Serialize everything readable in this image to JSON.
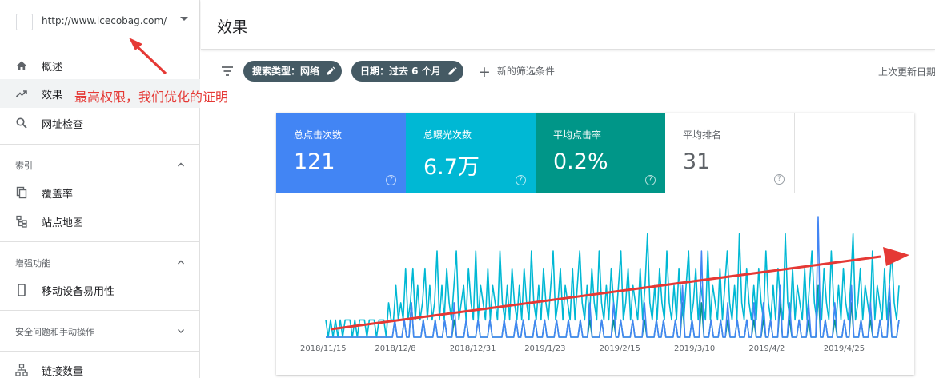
{
  "property": {
    "url": "http://www.icecobag.com/"
  },
  "nav": {
    "overview": "概述",
    "performance": "效果",
    "url_inspection": "网址检查",
    "index_section": "索引",
    "coverage": "覆盖率",
    "sitemaps": "站点地图",
    "enhancements_section": "增强功能",
    "mobile_usability": "移动设备易用性",
    "security_section": "安全问题和手动操作",
    "links": "链接数量"
  },
  "header": {
    "title": "效果"
  },
  "filters": {
    "search_type": "搜索类型：网络",
    "date": "日期：过去 6 个月",
    "add_filter": "新的筛选条件",
    "last_updated": "上次更新日期"
  },
  "metrics": {
    "clicks": {
      "label": "总点击次数",
      "value": "121"
    },
    "impressions": {
      "label": "总曝光次数",
      "value": "6.7万"
    },
    "ctr": {
      "label": "平均点击率",
      "value": "0.2%"
    },
    "position": {
      "label": "平均排名",
      "value": "31"
    }
  },
  "annotation": "最高权限，我们优化的证明",
  "colors": {
    "clicks": "#4285f4",
    "impressions": "#00b8d4",
    "ctr": "#009688",
    "position": "#9e9e9e",
    "annotation": "#e53935"
  },
  "chart_data": {
    "type": "line",
    "x_tick_labels": [
      "2018/11/15",
      "2018/12/8",
      "2018/12/31",
      "2019/1/23",
      "2019/2/15",
      "2019/3/10",
      "2019/4/2",
      "2019/4/25"
    ],
    "y_axis": "hidden",
    "series": [
      {
        "name": "总点击次数",
        "color": "#4285f4",
        "values": [
          0,
          0,
          0,
          0,
          0,
          0,
          0,
          0,
          0,
          0,
          0,
          0,
          0,
          0,
          0,
          0,
          0,
          0,
          0,
          0,
          0,
          0,
          0,
          0,
          0,
          0,
          0,
          0,
          0,
          1,
          0,
          0,
          0,
          1,
          0,
          0,
          2,
          0,
          0,
          0,
          0,
          1,
          0,
          0,
          0,
          0,
          1,
          0,
          0,
          0,
          1,
          0,
          0,
          0,
          2,
          0,
          0,
          0,
          0,
          1,
          0,
          0,
          0,
          0,
          1,
          0,
          0,
          0,
          0,
          1,
          0,
          0,
          0,
          0,
          0,
          1,
          0,
          0,
          0,
          0,
          1,
          0,
          0,
          1,
          0,
          0,
          0,
          0,
          1,
          0,
          0,
          0,
          1,
          0,
          0,
          0,
          0,
          1,
          0,
          0,
          0,
          0,
          1,
          0,
          0,
          0,
          0,
          1,
          0,
          0,
          0,
          2,
          0,
          0,
          0,
          0,
          1,
          0,
          0,
          0,
          0,
          2,
          0,
          0,
          1,
          0,
          0,
          0,
          0,
          1,
          0,
          0,
          0,
          0,
          2,
          0,
          0,
          0,
          0,
          1,
          0,
          0,
          1,
          0,
          0,
          0,
          0,
          1,
          0,
          0,
          3,
          0,
          0,
          0,
          1,
          0,
          0,
          0,
          5,
          0,
          0,
          0,
          1,
          0,
          0,
          0,
          1,
          0,
          0,
          2,
          0,
          0,
          0,
          1,
          0,
          0,
          0,
          1,
          0,
          0,
          2,
          0,
          0,
          0,
          2,
          0,
          0,
          1,
          0,
          0,
          0,
          3,
          0,
          0,
          0,
          2,
          0,
          0,
          0,
          1,
          0,
          0,
          0,
          2,
          0,
          0,
          0,
          7,
          0,
          0,
          1,
          0,
          0,
          0,
          2,
          0,
          0,
          0,
          1,
          0,
          0,
          3,
          0,
          0,
          0,
          1,
          0,
          0,
          0,
          2,
          0,
          0,
          0,
          1,
          0,
          0,
          0,
          3,
          0,
          0,
          0,
          1
        ]
      },
      {
        "name": "总曝光次数",
        "color": "#00b8d4",
        "values": [
          1,
          0,
          1,
          0,
          1,
          0,
          1,
          0,
          1,
          1,
          1,
          0,
          1,
          0,
          1,
          1,
          1,
          0,
          1,
          1,
          1,
          0,
          1,
          1,
          1,
          0,
          2,
          1,
          1,
          3,
          1,
          2,
          1,
          4,
          1,
          2,
          4,
          1,
          3,
          1,
          2,
          4,
          1,
          3,
          1,
          2,
          5,
          1,
          3,
          1,
          4,
          2,
          1,
          3,
          5,
          1,
          2,
          3,
          1,
          4,
          2,
          1,
          5,
          1,
          3,
          2,
          1,
          4,
          1,
          3,
          2,
          1,
          5,
          2,
          1,
          3,
          1,
          4,
          2,
          1,
          3,
          1,
          4,
          2,
          1,
          5,
          2,
          1,
          3,
          1,
          4,
          2,
          1,
          3,
          5,
          1,
          2,
          4,
          1,
          3,
          2,
          1,
          4,
          1,
          3,
          5,
          2,
          1,
          3,
          1,
          4,
          2,
          1,
          5,
          2,
          1,
          3,
          1,
          4,
          2,
          1,
          3,
          5,
          1,
          2,
          4,
          1,
          3,
          2,
          1,
          4,
          1,
          3,
          6,
          2,
          1,
          3,
          1,
          4,
          2,
          1,
          5,
          2,
          1,
          3,
          1,
          4,
          2,
          1,
          3,
          5,
          1,
          2,
          4,
          1,
          3,
          2,
          1,
          5,
          1,
          3,
          2,
          1,
          4,
          1,
          3,
          5,
          2,
          1,
          3,
          1,
          6,
          2,
          1,
          4,
          2,
          1,
          3,
          1,
          4,
          2,
          1,
          5,
          2,
          1,
          3,
          1,
          4,
          2,
          1,
          6,
          2,
          1,
          4,
          1,
          3,
          2,
          1,
          4,
          1,
          3,
          5,
          2,
          1,
          3,
          1,
          4,
          2,
          1,
          5,
          2,
          1,
          3,
          1,
          4,
          2,
          1,
          3,
          6,
          1,
          2,
          4,
          1,
          3,
          2,
          1,
          5,
          1,
          3,
          2,
          1,
          4,
          1,
          3,
          5,
          2,
          1,
          3
        ]
      },
      {
        "name": "平均点击率",
        "color": "#009688",
        "values": [
          0,
          0,
          0,
          0,
          0,
          0,
          0,
          0,
          0,
          0,
          0,
          0,
          0,
          0,
          0,
          0,
          0,
          0,
          0,
          0,
          0,
          0,
          0,
          0,
          0,
          0,
          0,
          0,
          0,
          1,
          0,
          0,
          0,
          1,
          0,
          0,
          2,
          0,
          0,
          0,
          0,
          1,
          0,
          0,
          0,
          0,
          1,
          0,
          0,
          0,
          1,
          0,
          0,
          0,
          1,
          0,
          0,
          0,
          0,
          1,
          0,
          0,
          0,
          0,
          1,
          0,
          0,
          0,
          0,
          1,
          0,
          0,
          0,
          0,
          0,
          1,
          0,
          0,
          0,
          0,
          1,
          0,
          0,
          1,
          0,
          0,
          0,
          0,
          1,
          0,
          0,
          0,
          1,
          0,
          0,
          0,
          0,
          1,
          0,
          0,
          0,
          0,
          1,
          0,
          0,
          0,
          0,
          1,
          0,
          0,
          0,
          1,
          0,
          0,
          0,
          0,
          1,
          0,
          0,
          0,
          0,
          1,
          0,
          0,
          1,
          0,
          0,
          0,
          0,
          1,
          0,
          0,
          0,
          0,
          1,
          0,
          0,
          0,
          0,
          1,
          0,
          0,
          1,
          0,
          0,
          0,
          0,
          1,
          0,
          0,
          2,
          0,
          0,
          0,
          1,
          0,
          0,
          0,
          2,
          0,
          0,
          0,
          1,
          0,
          0,
          0,
          1,
          0,
          0,
          1,
          0,
          0,
          0,
          1,
          0,
          0,
          0,
          1,
          0,
          0,
          1,
          0,
          0,
          0,
          1,
          0,
          0,
          1,
          0,
          0,
          0,
          2,
          0,
          0,
          0,
          1,
          0,
          0,
          0,
          1,
          0,
          0,
          0,
          1,
          0,
          0,
          0,
          3,
          0,
          0,
          1,
          0,
          0,
          0,
          1,
          0,
          0,
          0,
          1,
          0,
          0,
          2,
          0,
          0,
          0,
          1,
          0,
          0,
          0,
          1,
          0,
          0,
          0,
          1,
          0,
          0,
          0,
          2,
          0,
          0,
          0,
          1
        ]
      }
    ]
  }
}
